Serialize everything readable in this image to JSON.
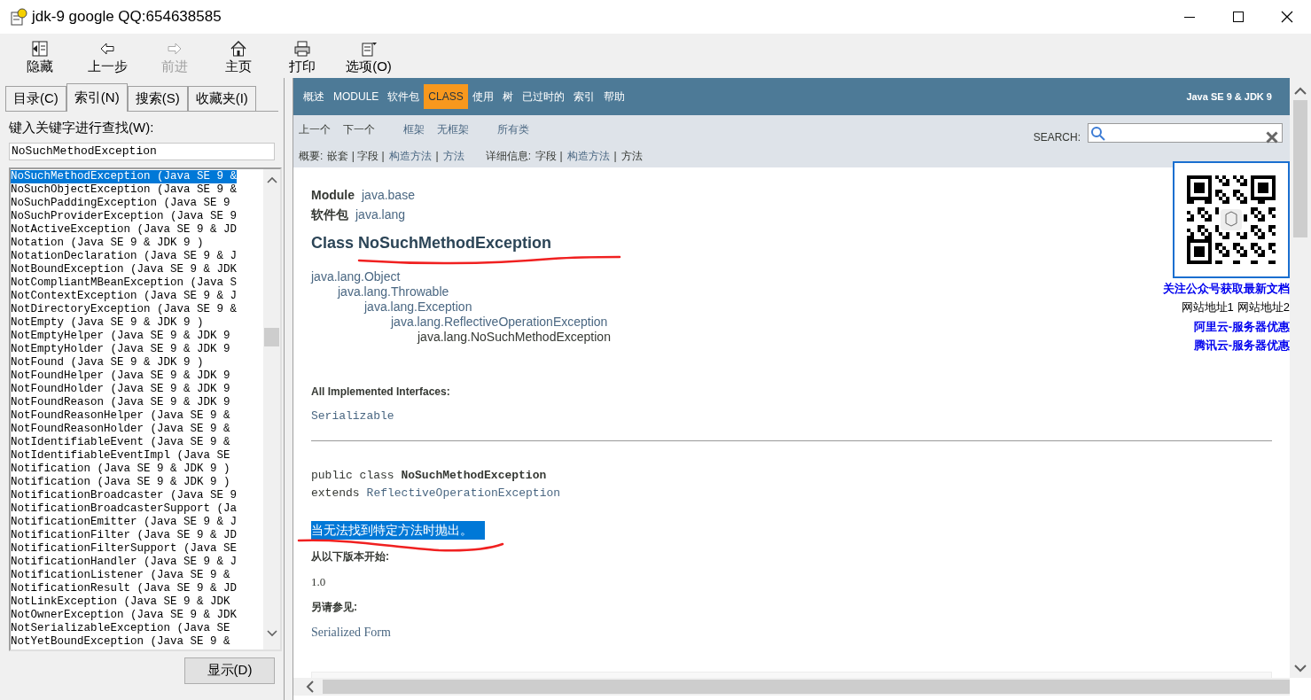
{
  "window": {
    "title": "jdk-9 google QQ:654638585"
  },
  "toolbar": [
    {
      "kind": "hide",
      "label": "隐藏",
      "disabled": false
    },
    {
      "kind": "back",
      "label": "上一步",
      "disabled": false
    },
    {
      "kind": "forward",
      "label": "前进",
      "disabled": true
    },
    {
      "kind": "home",
      "label": "主页",
      "disabled": false
    },
    {
      "kind": "print",
      "label": "打印",
      "disabled": false
    },
    {
      "kind": "options",
      "label": "选项(O)",
      "disabled": false
    }
  ],
  "left_panel": {
    "tabs": [
      {
        "label": "目录(C)",
        "selected": false
      },
      {
        "label": "索引(N)",
        "selected": true
      },
      {
        "label": "搜索(S)",
        "selected": false
      },
      {
        "label": "收藏夹(I)",
        "selected": false
      }
    ],
    "keyword_label": "键入关键字进行查找(W):",
    "keyword_value": "NoSuchMethodException",
    "results": [
      {
        "text": "NoSuchMethodException (Java SE 9 &",
        "selected": true
      },
      {
        "text": "NoSuchObjectException (Java SE 9 &",
        "selected": false
      },
      {
        "text": "NoSuchPaddingException (Java SE 9",
        "selected": false
      },
      {
        "text": "NoSuchProviderException (Java SE 9",
        "selected": false
      },
      {
        "text": "NotActiveException (Java SE 9 & JD",
        "selected": false
      },
      {
        "text": "Notation (Java SE 9 & JDK 9 )",
        "selected": false
      },
      {
        "text": "NotationDeclaration (Java SE 9 & J",
        "selected": false
      },
      {
        "text": "NotBoundException (Java SE 9 & JDK",
        "selected": false
      },
      {
        "text": "NotCompliantMBeanException (Java S",
        "selected": false
      },
      {
        "text": "NotContextException (Java SE 9 & J",
        "selected": false
      },
      {
        "text": "NotDirectoryException (Java SE 9 &",
        "selected": false
      },
      {
        "text": "NotEmpty (Java SE 9 & JDK 9 )",
        "selected": false
      },
      {
        "text": "NotEmptyHelper (Java SE 9 & JDK 9",
        "selected": false
      },
      {
        "text": "NotEmptyHolder (Java SE 9 & JDK 9",
        "selected": false
      },
      {
        "text": "NotFound (Java SE 9 & JDK 9 )",
        "selected": false
      },
      {
        "text": "NotFoundHelper (Java SE 9 & JDK 9",
        "selected": false
      },
      {
        "text": "NotFoundHolder (Java SE 9 & JDK 9",
        "selected": false
      },
      {
        "text": "NotFoundReason (Java SE 9 & JDK 9",
        "selected": false
      },
      {
        "text": "NotFoundReasonHelper (Java SE 9 &",
        "selected": false
      },
      {
        "text": "NotFoundReasonHolder (Java SE 9 &",
        "selected": false
      },
      {
        "text": "NotIdentifiableEvent (Java SE 9 &",
        "selected": false
      },
      {
        "text": "NotIdentifiableEventImpl (Java SE",
        "selected": false
      },
      {
        "text": "Notification (Java SE 9 & JDK 9 )",
        "selected": false
      },
      {
        "text": "Notification (Java SE 9 & JDK 9 )",
        "selected": false
      },
      {
        "text": "NotificationBroadcaster (Java SE 9",
        "selected": false
      },
      {
        "text": "NotificationBroadcasterSupport (Ja",
        "selected": false
      },
      {
        "text": "NotificationEmitter (Java SE 9 & J",
        "selected": false
      },
      {
        "text": "NotificationFilter (Java SE 9 & JD",
        "selected": false
      },
      {
        "text": "NotificationFilterSupport (Java SE",
        "selected": false
      },
      {
        "text": "NotificationHandler (Java SE 9 & J",
        "selected": false
      },
      {
        "text": "NotificationListener (Java SE 9 &",
        "selected": false
      },
      {
        "text": "NotificationResult (Java SE 9 & JD",
        "selected": false
      },
      {
        "text": "NotLinkException (Java SE 9 & JDK",
        "selected": false
      },
      {
        "text": "NotOwnerException (Java SE 9 & JDK",
        "selected": false
      },
      {
        "text": "NotSerializableException (Java SE",
        "selected": false
      },
      {
        "text": "NotYetBoundException (Java SE 9 &",
        "selected": false
      }
    ],
    "display_button": "显示(D)"
  },
  "doc": {
    "nav": [
      {
        "label": "概述",
        "selected": false
      },
      {
        "label": "MODULE",
        "selected": false
      },
      {
        "label": "软件包",
        "selected": false
      },
      {
        "label": "CLASS",
        "selected": true
      },
      {
        "label": "使用",
        "selected": false
      },
      {
        "label": "树",
        "selected": false
      },
      {
        "label": "已过时的",
        "selected": false
      },
      {
        "label": "索引",
        "selected": false
      },
      {
        "label": "帮助",
        "selected": false
      }
    ],
    "nav_title": "Java SE 9 & JDK 9",
    "subnav_groups": [
      [
        {
          "text": "上一个",
          "link": false
        },
        {
          "text": "下一个",
          "link": false
        }
      ],
      [
        {
          "text": "框架",
          "link": true
        },
        {
          "text": "无框架",
          "link": true
        }
      ],
      [
        {
          "text": "所有类",
          "link": true
        }
      ]
    ],
    "search_label": "SEARCH:",
    "summary": [
      {
        "text": "概要:",
        "link": false
      },
      {
        "text": "嵌套 | 字段 |",
        "link": false
      },
      {
        "text": "构造方法",
        "link": true
      },
      {
        "text": "|",
        "link": false
      },
      {
        "text": "方法",
        "link": true
      }
    ],
    "detail": [
      {
        "text": "详细信息:",
        "link": false
      },
      {
        "text": "字段 |",
        "link": false
      },
      {
        "text": "构造方法",
        "link": true
      },
      {
        "text": "|",
        "link": false
      },
      {
        "text": "方法",
        "link": false
      }
    ],
    "module_label": "Module",
    "module": "java.base",
    "package_label": "软件包",
    "package": "java.lang",
    "title": "Class NoSuchMethodException",
    "hierarchy": [
      {
        "text": "java.lang.Object",
        "children": [
          {
            "text": "java.lang.Throwable",
            "children": [
              {
                "text": "java.lang.Exception",
                "children": [
                  {
                    "text": "java.lang.ReflectiveOperationException",
                    "children": [
                      {
                        "text": "java.lang.NoSuchMethodException"
                      }
                    ]
                  }
                ]
              }
            ]
          }
        ]
      }
    ],
    "interfaces_label": "All Implemented Interfaces:",
    "interfaces": "Serializable",
    "signature": "public class **NoSuchMethodException**",
    "extends_label": "extends",
    "extends": "ReflectiveOperationException",
    "description": "当无法找到特定方法时抛出。",
    "description_highlighted": true,
    "since_label": "从以下版本开始:",
    "since": "1.0",
    "see_label": "另请参见:",
    "see": "Serialized Form"
  },
  "promo": {
    "follow": "关注公众号获取最新文档",
    "sites": [
      "网站地址1",
      "网站地址2"
    ],
    "offers": [
      "阿里云-服务器优惠",
      "腾讯云-服务器优惠"
    ]
  }
}
